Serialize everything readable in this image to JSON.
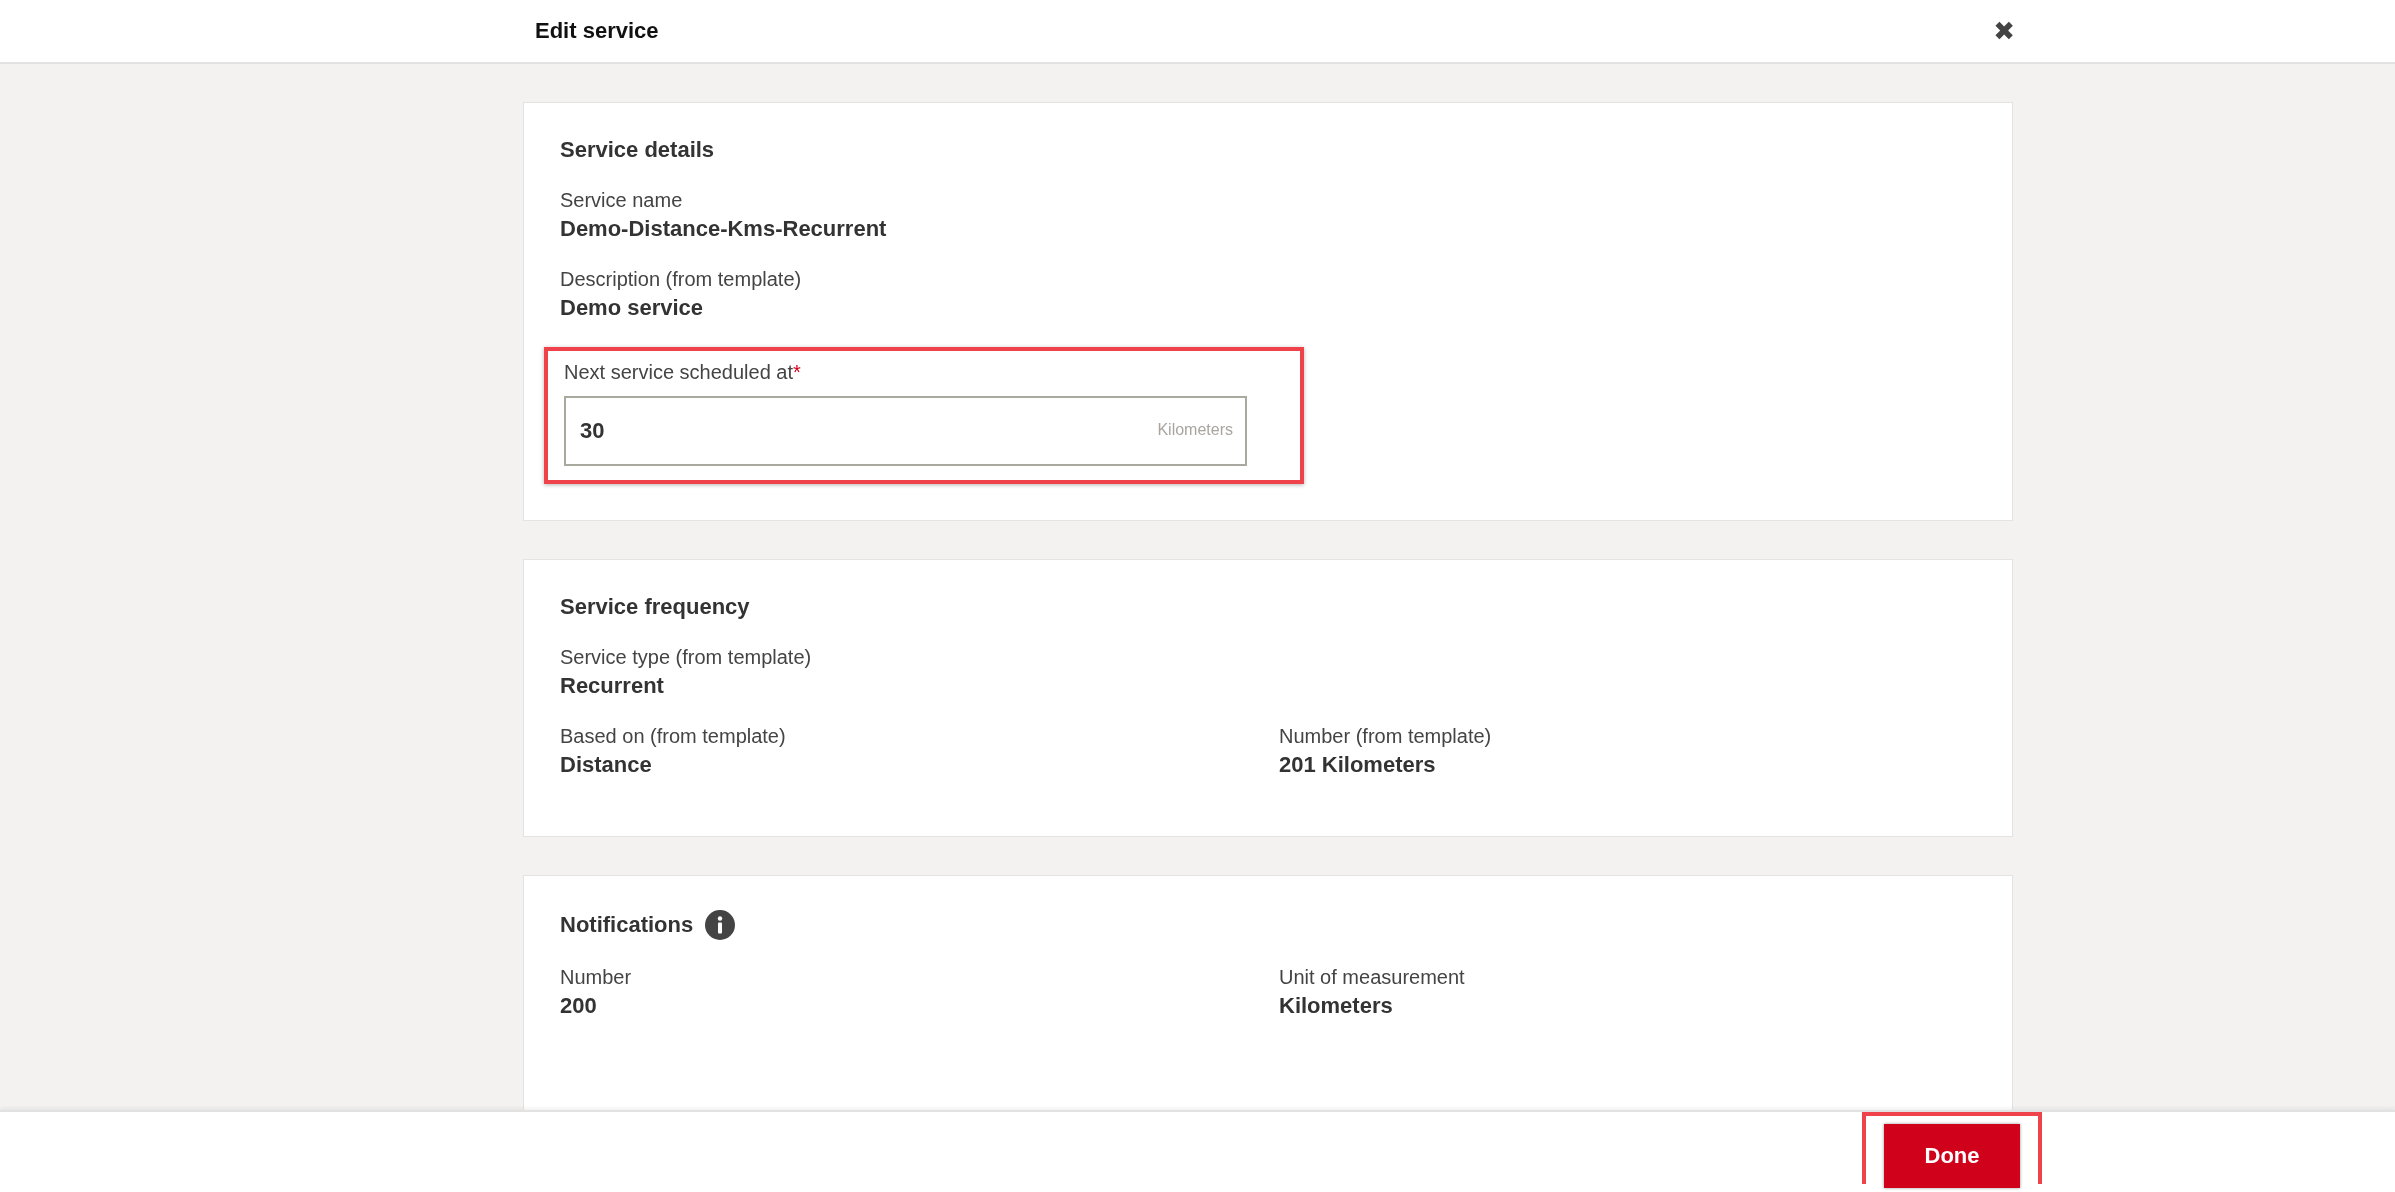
{
  "dialog": {
    "title": "Edit service",
    "close": "✖"
  },
  "sections": [
    {
      "title": "Service details",
      "info": false,
      "items": [
        {
          "kind": "text",
          "label": "Service name",
          "value": "Demo-Distance-Kms-Recurrent"
        },
        {
          "kind": "text",
          "label": "Description (from template)",
          "value": "Demo service"
        },
        {
          "kind": "field",
          "label": "Next service scheduled at",
          "required": true,
          "required_mark": "*",
          "highlighted": true,
          "value": "30",
          "unit": "Kilometers"
        }
      ]
    },
    {
      "title": "Service frequency",
      "info": false,
      "items": [
        {
          "kind": "text",
          "label": "Service type (from template)",
          "value": "Recurrent"
        },
        {
          "kind": "pair",
          "cells": [
            {
              "label": "Based on (from template)",
              "value": "Distance"
            },
            {
              "label": "Number (from template)",
              "value": "201 Kilometers"
            }
          ]
        }
      ]
    },
    {
      "title": "Notifications",
      "info": true,
      "items": [
        {
          "kind": "pair",
          "cells": [
            {
              "label": "Number",
              "value": "200"
            },
            {
              "label": "Unit of measurement",
              "value": "Kilometers"
            }
          ]
        }
      ]
    }
  ],
  "footer": {
    "done": {
      "label": "Done",
      "highlighted": true
    }
  }
}
